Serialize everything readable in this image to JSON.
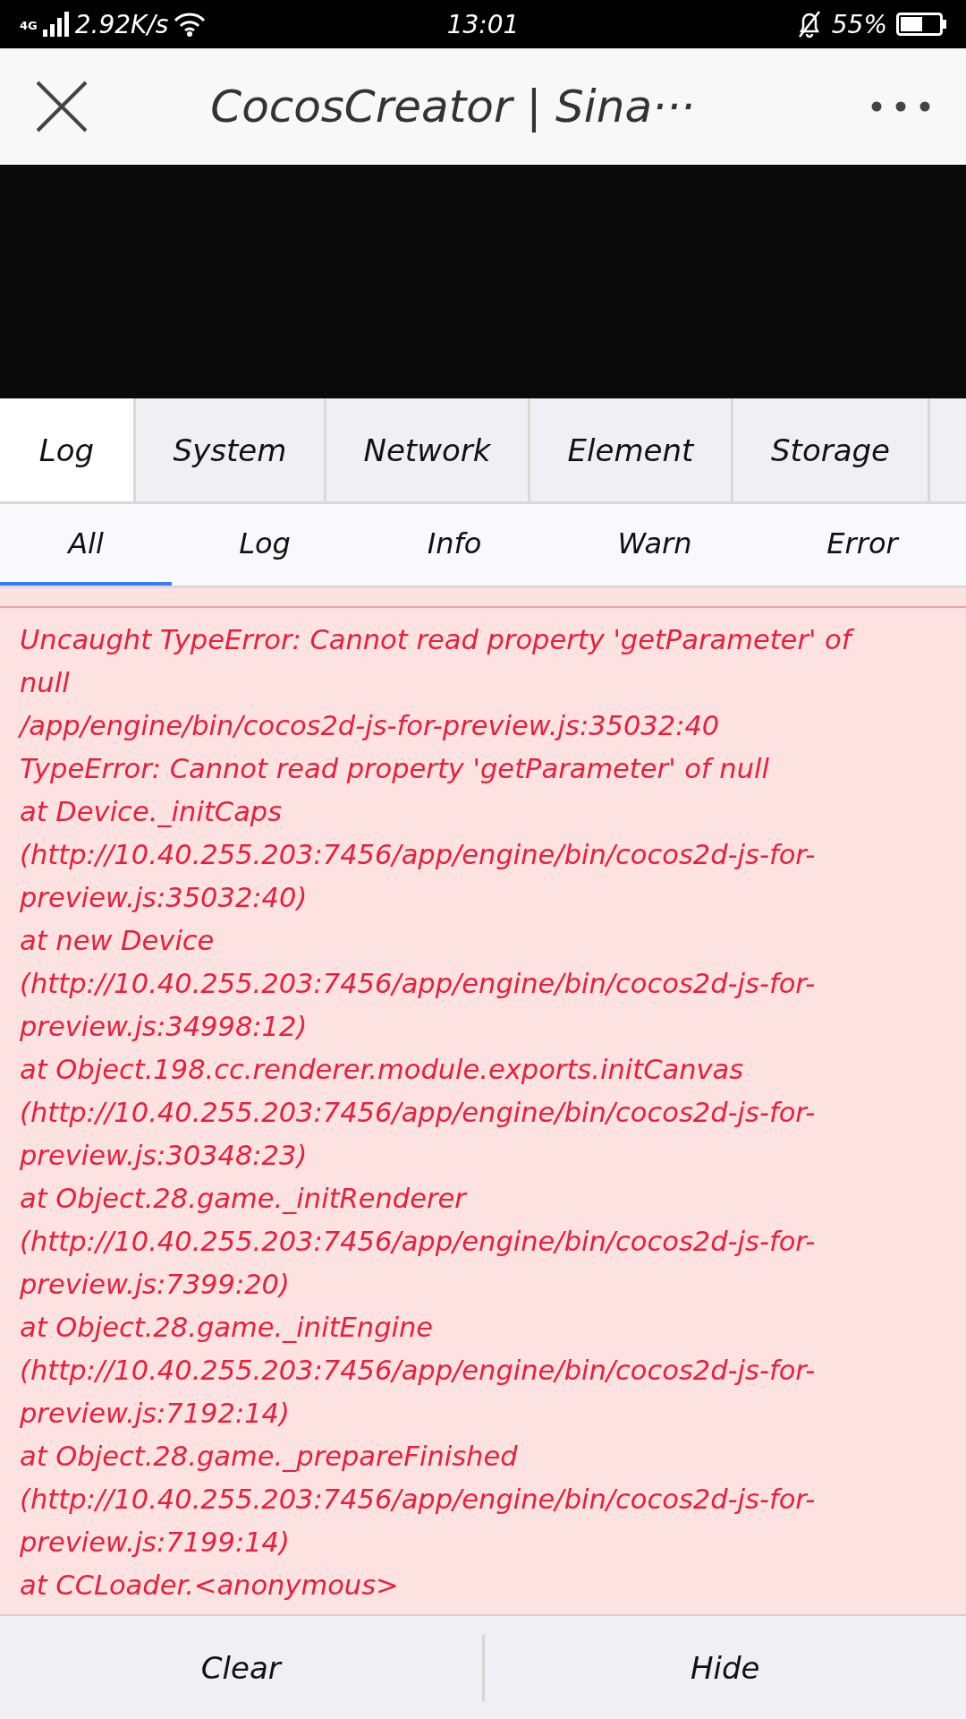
{
  "status_bar": {
    "network": "4G",
    "speed": "2.92K/s",
    "time": "13:01",
    "battery": "55%"
  },
  "header": {
    "title": "CocosCreator | Sina···"
  },
  "tabs": [
    {
      "label": "Log",
      "selected": true
    },
    {
      "label": "System",
      "selected": false
    },
    {
      "label": "Network",
      "selected": false
    },
    {
      "label": "Element",
      "selected": false
    },
    {
      "label": "Storage",
      "selected": false
    }
  ],
  "filters": [
    {
      "label": "All",
      "selected": true
    },
    {
      "label": "Log",
      "selected": false
    },
    {
      "label": "Info",
      "selected": false
    },
    {
      "label": "Warn",
      "selected": false
    },
    {
      "label": "Error",
      "selected": false
    }
  ],
  "log_entries": [
    {
      "kind": "error",
      "lines": [
        "Uncaught TypeError: Cannot read property 'getParameter' of",
        "null",
        "/app/engine/bin/cocos2d-js-for-preview.js:35032:40",
        "TypeError: Cannot read property 'getParameter' of null",
        "at Device._initCaps",
        "(http://10.40.255.203:7456/app/engine/bin/cocos2d-js-for-",
        "preview.js:35032:40)",
        "at new Device",
        "(http://10.40.255.203:7456/app/engine/bin/cocos2d-js-for-",
        "preview.js:34998:12)",
        "at Object.198.cc.renderer.module.exports.initCanvas",
        "(http://10.40.255.203:7456/app/engine/bin/cocos2d-js-for-",
        "preview.js:30348:23)",
        "at Object.28.game._initRenderer",
        "(http://10.40.255.203:7456/app/engine/bin/cocos2d-js-for-",
        "preview.js:7399:20)",
        "at Object.28.game._initEngine",
        "(http://10.40.255.203:7456/app/engine/bin/cocos2d-js-for-",
        "preview.js:7192:14)",
        "at Object.28.game._prepareFinished",
        "(http://10.40.255.203:7456/app/engine/bin/cocos2d-js-for-",
        "preview.js:7199:14)",
        "at CCLoader.<anonymous>"
      ]
    }
  ],
  "buttons": [
    {
      "label": "Clear"
    },
    {
      "label": "Hide"
    }
  ]
}
